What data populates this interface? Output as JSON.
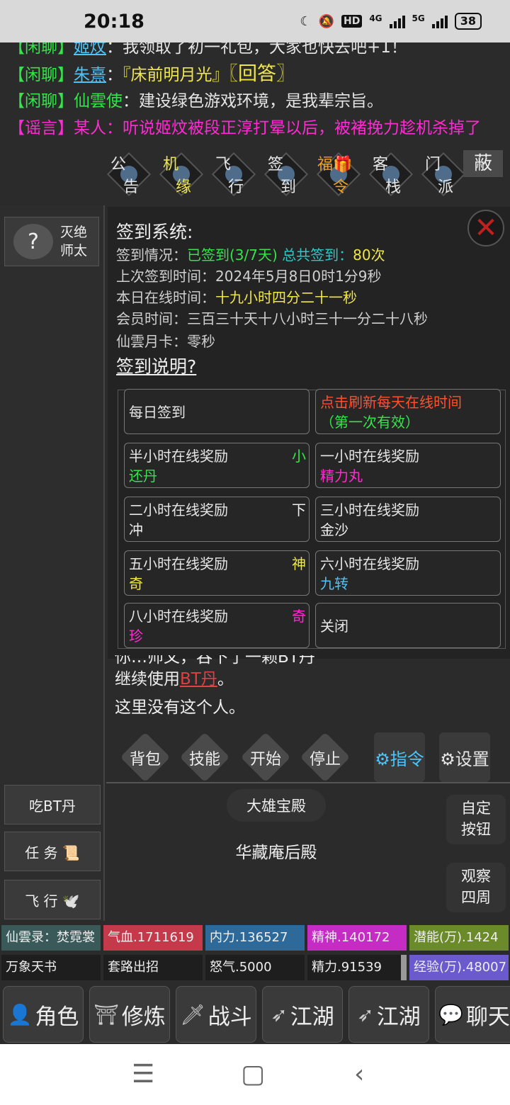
{
  "status": {
    "time": "20:18",
    "hd": "HD",
    "net1": "4G",
    "net2": "5G",
    "battery": "38"
  },
  "chat": {
    "lines": [
      {
        "tag": "【闲聊】",
        "name": "姬炆",
        "sep": "：",
        "text": "我领取了初一礼包，大家也快去吧+1！"
      },
      {
        "tag": "【闲聊】",
        "name": "朱熹",
        "sep": "：",
        "text": "『床前明月光』",
        "link": "〖回答〗"
      },
      {
        "tag": "【闲聊】",
        "name": "仙雲使",
        "sep": "：",
        "text": "建设绿色游戏环境，是我辈宗旨。"
      },
      {
        "tag": "【谣言】",
        "name": "某人",
        "sep": "：",
        "text": "听说姬炆被段正淳打晕以后，被褚挽力趁机杀掉了"
      }
    ]
  },
  "topnav": [
    {
      "a": "公",
      "b": "告"
    },
    {
      "a": "机",
      "b": "缘"
    },
    {
      "a": "飞",
      "b": "行"
    },
    {
      "a": "签",
      "b": "到"
    },
    {
      "a": "福🎁",
      "b": "令"
    },
    {
      "a": "客",
      "b": "栈"
    },
    {
      "a": "门",
      "b": "派"
    }
  ],
  "hide_label": "蔽",
  "npc": {
    "avatar": "?",
    "name1": "灭绝",
    "name2": "师太"
  },
  "left_buttons": {
    "eat": "吃BT丹",
    "task": "任 务 📜",
    "fly": "飞 行 🕊️"
  },
  "panel": {
    "title": "签到系统:",
    "status_label": "签到情况：",
    "signed": "已签到",
    "signed_count": "(3/7天)",
    "total_label": "总共签到：",
    "total_value": "80次",
    "last_label": "上次签到时间：",
    "last_value": "2024年5月8日0时1分9秒",
    "online_label": "本日在线时间：",
    "online_value": "十九小时四分二十一秒",
    "member_label": "会员时间：",
    "member_value": "三百三十天十八小时三十一分二十八秒",
    "card_label": "仙雲月卡：",
    "card_value": "零秒",
    "help": "签到说明?",
    "close": "✕",
    "cells": {
      "daily": "每日签到",
      "refresh1": "点击刷新每天在线时间",
      "refresh2": "（第一次有效）",
      "half_label": "半小时在线奖励",
      "half_r": "小",
      "half_b": "还丹",
      "one_label": "一小时在线奖励",
      "one_b": "精力丸",
      "two_label": "二小时在线奖励",
      "two_r": "下",
      "two_b": "冲",
      "three_label": "三小时在线奖励",
      "three_b": "金沙",
      "five_label": "五小时在线奖励",
      "five_r": "神",
      "five_b": "奇",
      "six_label": "六小时在线奖励",
      "six_b": "九转",
      "eight_label": "八小时在线奖励",
      "eight_r": "奇",
      "eight_b": "珍",
      "close_label": "关闭"
    }
  },
  "messages": {
    "partial": "你…师父，吞下了一颗BT丹",
    "continue_prefix": "继续使用",
    "continue_link": "BT丹",
    "continue_suffix": "。",
    "not_here": "这里没有这个人。"
  },
  "actions": {
    "bag": "背包",
    "skill": "技能",
    "start": "开始",
    "stop": "停止",
    "command": "⚙指令",
    "settings": "⚙设置"
  },
  "exits": {
    "north": "大雄宝殿",
    "here": "华藏庵后殿"
  },
  "right_buttons": {
    "custom1": "自定",
    "custom2": "按钮",
    "observe1": "观察",
    "observe2": "四周"
  },
  "stats": {
    "row1": [
      "仙雲录：焚霓裳",
      "气血.1711619",
      "内力.136527",
      "精神.140172",
      "潜能(万).1424"
    ],
    "row2": [
      "万象天书",
      "套路出招",
      "怒气.5000",
      "精力.91539",
      "经验(万).48007"
    ]
  },
  "tabs": [
    {
      "icon": "👤",
      "label": "角色"
    },
    {
      "icon": "⛩",
      "label": "修炼"
    },
    {
      "icon": "🗡",
      "label": "战斗"
    },
    {
      "icon": "➶",
      "label": "江湖"
    },
    {
      "icon": "➶",
      "label": "江湖"
    },
    {
      "icon": "💬",
      "label": "聊天"
    }
  ],
  "colors": {
    "tag_green": "#35e34a",
    "tag_red": "#ff2bd2",
    "name_link": "#4fc3f7",
    "hp": "#c43a4a",
    "mp": "#2d6a9a",
    "spirit": "#c42cc4",
    "potential": "#6b8a2a",
    "exp": "#6a5acd"
  }
}
